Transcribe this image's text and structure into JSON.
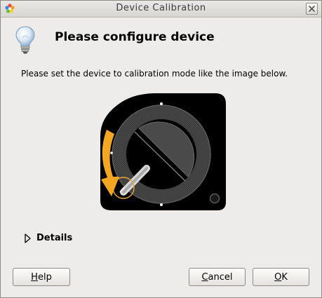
{
  "window": {
    "title": "Device Calibration"
  },
  "header": {
    "title": "Please configure device"
  },
  "main": {
    "instruction": "Please set the device to calibration mode like the image below."
  },
  "details": {
    "label": "Details"
  },
  "buttons": {
    "help_mnemonic": "H",
    "help_rest": "elp",
    "cancel_mnemonic": "C",
    "cancel_rest": "ancel",
    "ok_mnemonic": "O",
    "ok_rest": "K"
  },
  "colors": {
    "device_body": "#000000",
    "arrow_accent": "#f3a621",
    "dial_ring": "#575757",
    "dial_face": "#3f3f3f"
  },
  "icons": {
    "app": "gnome-flower-icon",
    "header": "lightbulb-icon",
    "close": "close-icon",
    "details": "triangle-right-icon"
  }
}
